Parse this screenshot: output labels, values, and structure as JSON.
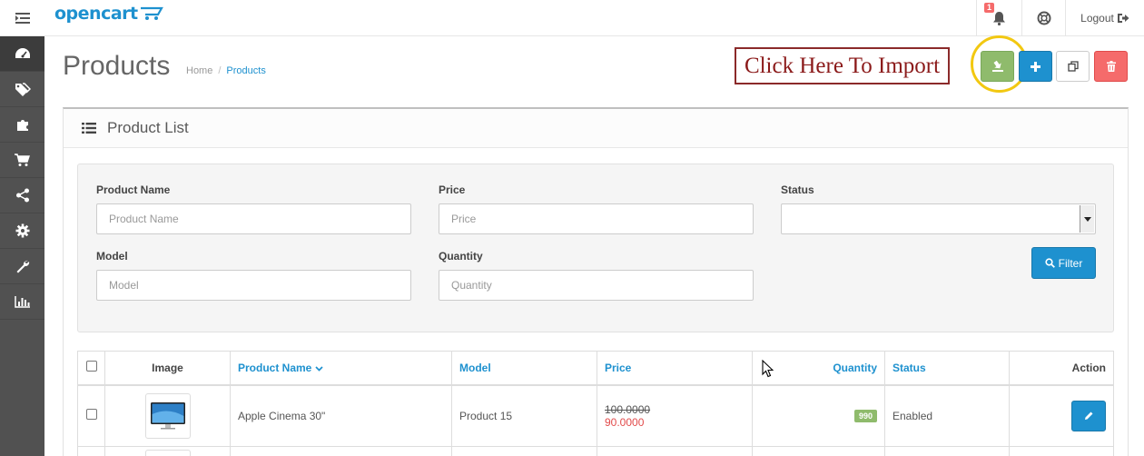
{
  "header": {
    "logo_text": "opencart",
    "notification_count": "1",
    "logout_label": "Logout"
  },
  "sidebar": {
    "items": [
      {
        "icon": "dashboard-icon"
      },
      {
        "icon": "tags-icon"
      },
      {
        "icon": "puzzle-icon"
      },
      {
        "icon": "cart-icon"
      },
      {
        "icon": "share-icon"
      },
      {
        "icon": "gear-icon"
      },
      {
        "icon": "wrench-icon"
      },
      {
        "icon": "bar-chart-icon"
      }
    ]
  },
  "page": {
    "title": "Products",
    "breadcrumb": [
      "Home",
      "Products"
    ],
    "import_note": "Click Here To Import"
  },
  "panel": {
    "title": "Product List"
  },
  "filter": {
    "product_name_label": "Product Name",
    "product_name_placeholder": "Product Name",
    "price_label": "Price",
    "price_placeholder": "Price",
    "status_label": "Status",
    "status_value": "",
    "model_label": "Model",
    "model_placeholder": "Model",
    "quantity_label": "Quantity",
    "quantity_placeholder": "Quantity",
    "filter_button": "Filter"
  },
  "table": {
    "columns": [
      "Image",
      "Product Name",
      "Model",
      "Price",
      "Quantity",
      "Status",
      "Action"
    ],
    "rows": [
      {
        "name": "Apple Cinema 30\"",
        "model": "Product 15",
        "price": "100.0000",
        "special": "90.0000",
        "quantity": "990",
        "status": "Enabled"
      }
    ]
  },
  "colors": {
    "primary": "#1e91cf",
    "success": "#8fbb6c",
    "danger": "#f56b6b",
    "sidebar": "#515151",
    "highlight": "#f2c811",
    "note_border": "#8b2a2a"
  }
}
